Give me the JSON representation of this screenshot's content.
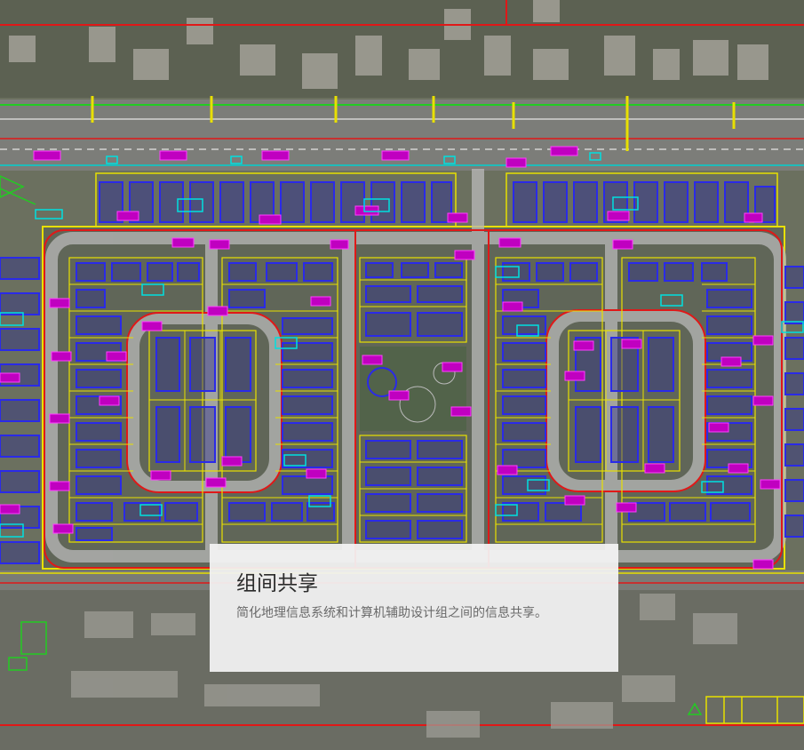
{
  "caption": {
    "title": "组间共享",
    "description": "简化地理信息系统和计算机辅助设计组之间的信息共享。"
  },
  "map_colors": {
    "parcel_line": "#e8e000",
    "building_outline": "#1a1ad0",
    "boundary": "#e01818",
    "label_magenta": "#e000e0",
    "label_cyan": "#00e0e0",
    "street": "#9a9a9a"
  }
}
